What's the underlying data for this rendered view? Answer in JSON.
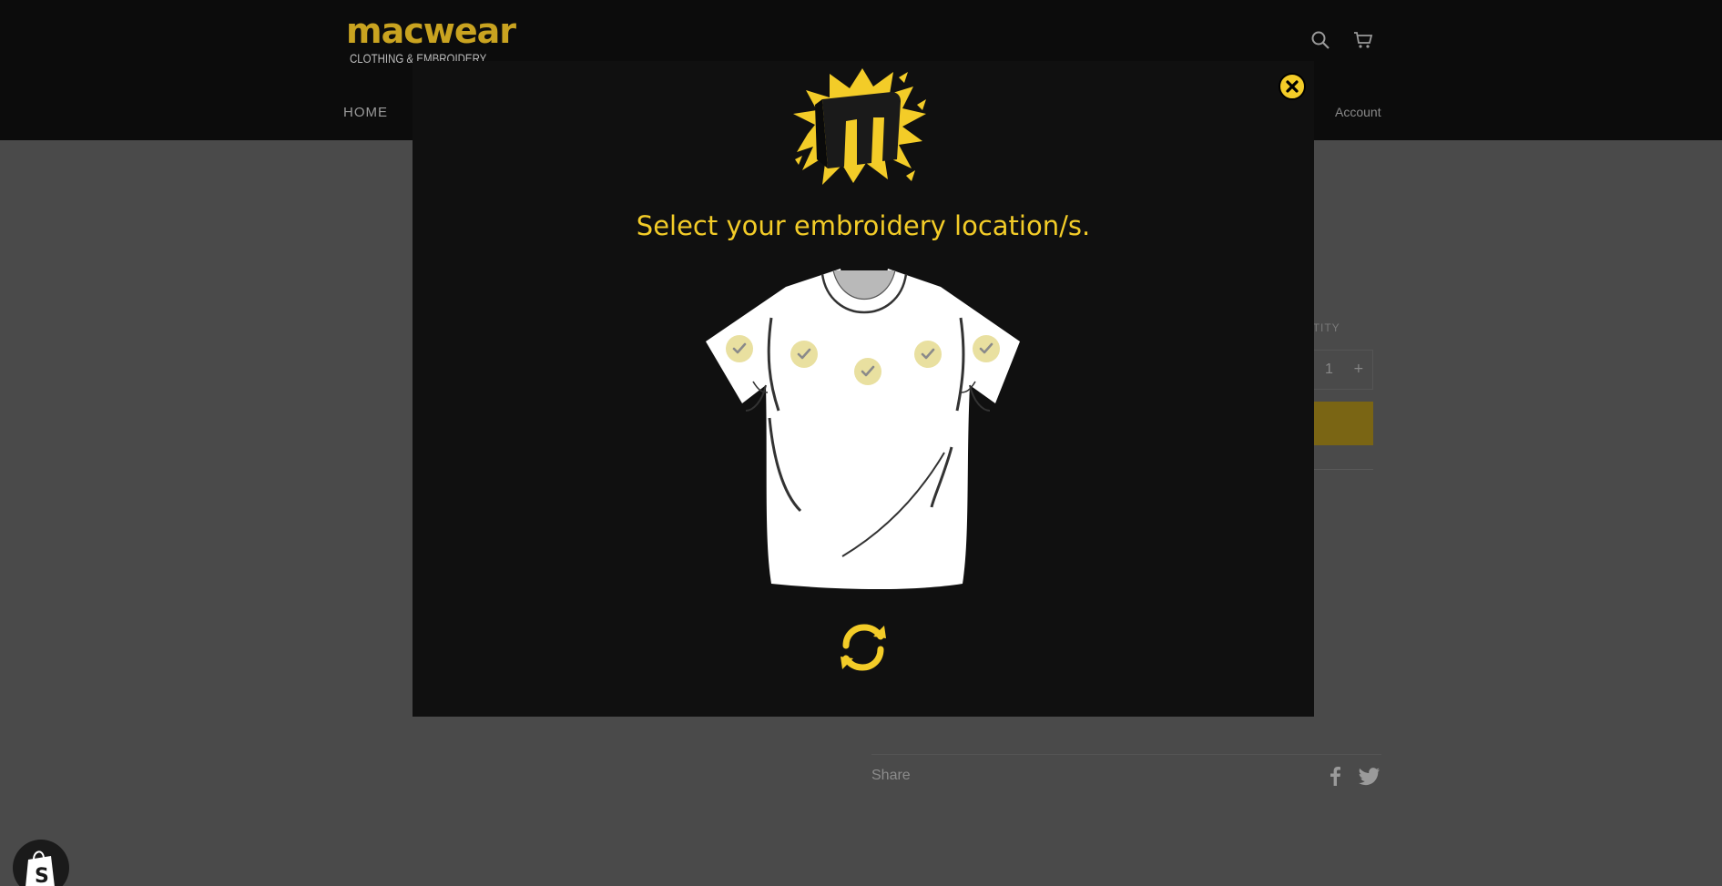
{
  "header": {
    "logo": {
      "wordmark": "macwear",
      "tagline": "CLOTHING & EMBROIDERY"
    },
    "nav": {
      "home": "HOME",
      "account": "Account"
    },
    "icons": [
      "search-icon",
      "cart-icon"
    ]
  },
  "product": {
    "quantity_label": "NTITY",
    "quantity_value": "1",
    "quantity_plus": "+",
    "share_label": "Share"
  },
  "modal": {
    "title": "Select your embroidery location/s.",
    "locations": [
      {
        "name": "right-sleeve",
        "selected": false
      },
      {
        "name": "right-chest",
        "selected": false
      },
      {
        "name": "center-chest",
        "selected": false
      },
      {
        "name": "left-chest",
        "selected": false
      },
      {
        "name": "left-sleeve",
        "selected": false
      }
    ],
    "colors": {
      "accent": "#f3cc28",
      "background": "#101010",
      "overlay": "#4a4a4a"
    }
  }
}
